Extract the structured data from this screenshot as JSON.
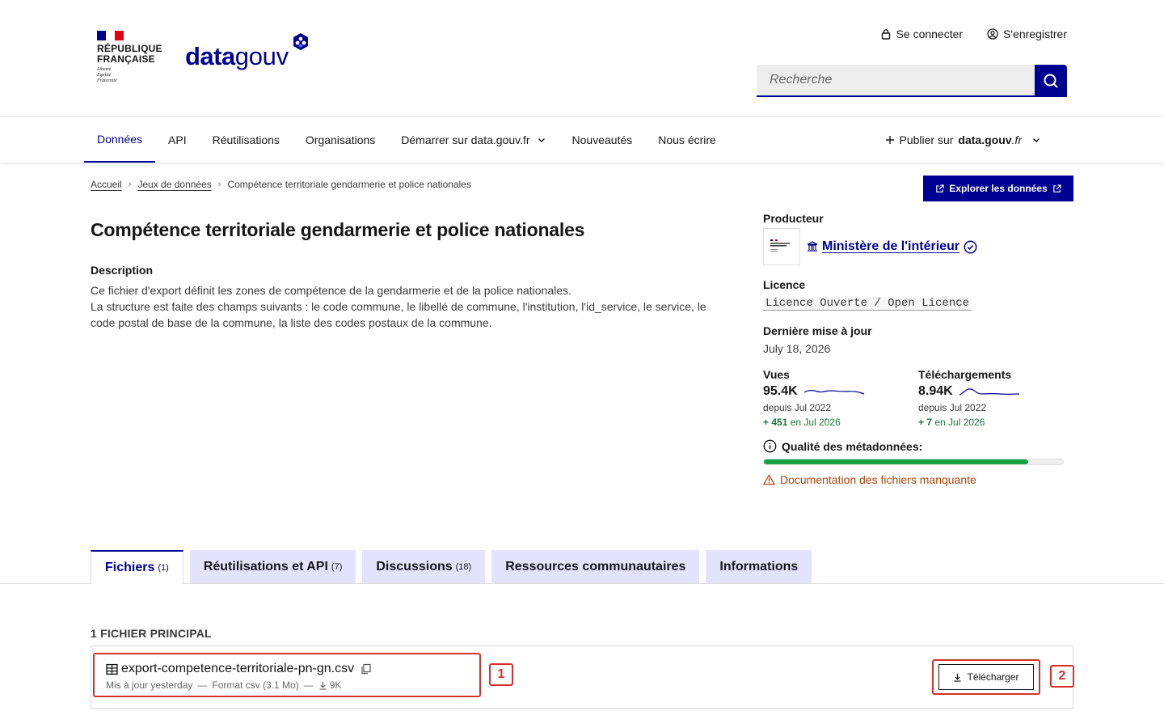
{
  "header": {
    "rf": {
      "line1": "République",
      "line2": "Française",
      "motto": [
        "Liberté",
        "Égalité",
        "Fraternité"
      ],
      "flag_colors": [
        "#000091",
        "#ffffff",
        "#e1000f"
      ]
    },
    "logo": {
      "part1": "data",
      "part2": "gouv"
    },
    "links": {
      "login": "Se connecter",
      "register": "S'enregistrer"
    },
    "search": {
      "placeholder": "Recherche"
    }
  },
  "nav": {
    "items": [
      "Données",
      "API",
      "Réutilisations",
      "Organisations",
      "Démarrer sur data.gouv.fr",
      "Nouveautés",
      "Nous écrire"
    ],
    "publish_prefix": "Publier sur ",
    "publish_brand": "data.gouv",
    "publish_suffix": ".fr"
  },
  "breadcrumb": {
    "home": "Accueil",
    "datasets": "Jeux de données",
    "current": "Compétence territoriale gendarmerie et police nationales"
  },
  "explore_label": "Explorer les données",
  "dataset": {
    "title": "Compétence territoriale gendarmerie et police nationales",
    "description_label": "Description",
    "description_lines": [
      "Ce fichier d'export définit les zones de compétence de la gendarmerie et de la police nationales.",
      "La structure est faite des champs suivants : le code commune, le libellé de commune, l'institution, l'id_service, le service, le code postal de base de la commune, la liste des codes postaux de la commune."
    ]
  },
  "side": {
    "producer_label": "Producteur",
    "producer_name": "Ministère de l'intérieur",
    "licence_label": "Licence",
    "licence": "Licence Ouverte / Open Licence",
    "updated_label": "Dernière mise à jour",
    "updated": "July 18, 2026",
    "views": {
      "label": "Vues",
      "value": "95.4K",
      "since": "depuis Jul 2022",
      "plus": "+ 451",
      "plus_suffix": " en Jul 2026"
    },
    "downloads": {
      "label": "Téléchargements",
      "value": "8.94K",
      "since": "depuis Jul 2022",
      "plus": "+ 7",
      "plus_suffix": " en Jul 2026"
    },
    "quality_label": "Qualité des métadonnées:",
    "quality_fraction": 0.885,
    "warning": "Documentation des fichiers manquante"
  },
  "tabs": [
    {
      "label": "Fichiers",
      "count": "(1)"
    },
    {
      "label": "Réutilisations et API",
      "count": "(7)"
    },
    {
      "label": "Discussions",
      "count": "(18)"
    },
    {
      "label": "Ressources communautaires",
      "count": ""
    },
    {
      "label": "Informations",
      "count": ""
    }
  ],
  "files": {
    "heading": "1 fichier principal",
    "file_name": "export-competence-territoriale-pn-gn.csv",
    "updated": "Mis à jour yesterday",
    "format": "Format csv (3.1 Mo)",
    "downloads": "9K",
    "download_label": "Télécharger",
    "badge1": "1",
    "badge2": "2"
  }
}
